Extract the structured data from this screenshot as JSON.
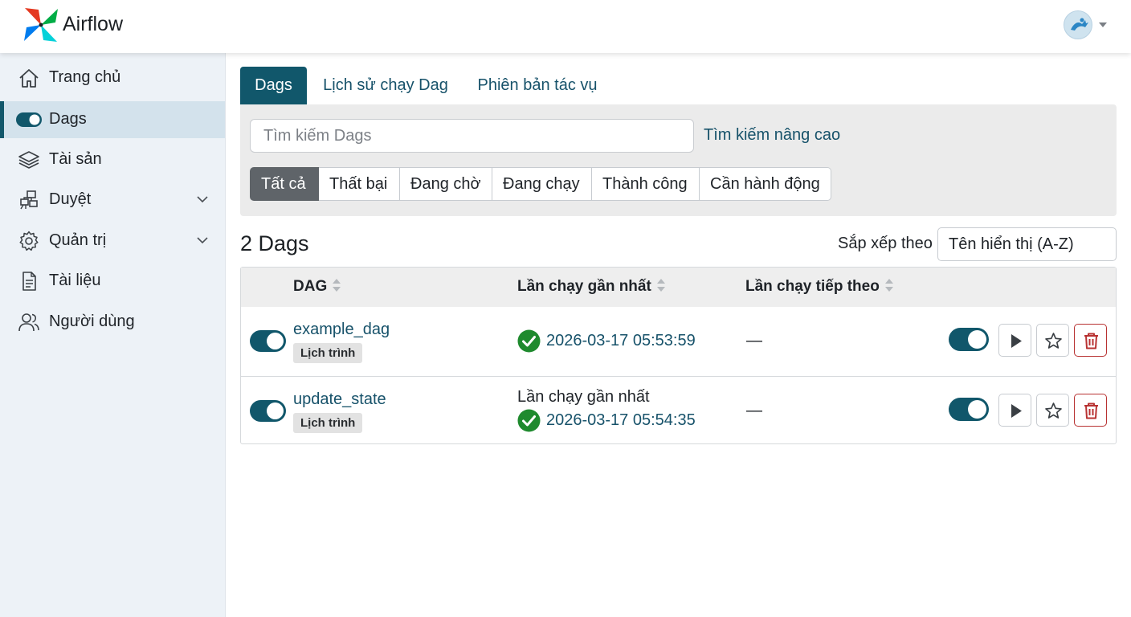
{
  "app": {
    "name": "Airflow"
  },
  "user_menu": {
    "avatar_icon": "user-avatar-icon"
  },
  "sidebar": {
    "items": [
      {
        "label": "Trang chủ",
        "icon": "home-icon"
      },
      {
        "label": "Dags",
        "icon": "toggle-icon",
        "active": true
      },
      {
        "label": "Tài sản",
        "icon": "layers-icon"
      },
      {
        "label": "Duyệt",
        "icon": "browse-icon",
        "expandable": true
      },
      {
        "label": "Quản trị",
        "icon": "gear-icon",
        "expandable": true
      },
      {
        "label": "Tài liệu",
        "icon": "document-icon"
      },
      {
        "label": "Người dùng",
        "icon": "users-icon"
      }
    ]
  },
  "tabs": [
    {
      "label": "Dags",
      "active": true
    },
    {
      "label": "Lịch sử chạy Dag"
    },
    {
      "label": "Phiên bản tác vụ"
    }
  ],
  "search": {
    "placeholder": "Tìm kiếm Dags",
    "value": "",
    "advanced_label": "Tìm kiếm nâng cao"
  },
  "filters": [
    {
      "label": "Tất cả",
      "active": true
    },
    {
      "label": "Thất bại"
    },
    {
      "label": "Đang chờ"
    },
    {
      "label": "Đang chạy"
    },
    {
      "label": "Thành công"
    },
    {
      "label": "Cần hành động"
    }
  ],
  "summary": {
    "count_title": "2 Dags"
  },
  "sort": {
    "label": "Sắp xếp theo",
    "value": "Tên hiển thị (A-Z)"
  },
  "table": {
    "headers": {
      "dag": "DAG",
      "last_run": "Lần chạy gần nhất",
      "next_run": "Lần chạy tiếp theo"
    },
    "rows": [
      {
        "name": "example_dag",
        "badge": "Lịch trình",
        "last_run_caption": "",
        "last_run": "2026-03-17 05:53:59",
        "last_run_status": "success",
        "next_run": "—",
        "enabled": true
      },
      {
        "name": "update_state",
        "badge": "Lịch trình",
        "last_run_caption": "Lần chạy gần nhất",
        "last_run": "2026-03-17 05:54:35",
        "last_run_status": "success",
        "next_run": "—",
        "enabled": true
      }
    ]
  },
  "colors": {
    "primary": "#11576b",
    "link": "#17526a",
    "success": "#1f8a2e",
    "danger": "#b83232",
    "sidebar_bg": "#edf2f7"
  }
}
